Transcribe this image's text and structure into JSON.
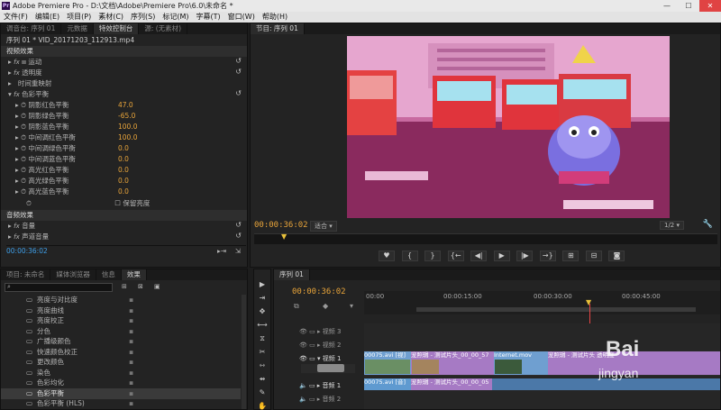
{
  "window": {
    "app_icon": "Pr",
    "title": "Adobe Premiere Pro - D:\\文档\\Adobe\\Premiere Pro\\6.0\\未命名 *",
    "min": "—",
    "max": "☐",
    "close": "✕"
  },
  "menu": [
    "文件(F)",
    "编辑(E)",
    "项目(P)",
    "素材(C)",
    "序列(S)",
    "标记(M)",
    "字幕(T)",
    "窗口(W)",
    "帮助(H)"
  ],
  "source_panel": {
    "tabs": [
      "源: (无素材)",
      "元数据",
      "特效控制台",
      "调音台: 序列 01"
    ],
    "active_tab": "特效控制台",
    "sequence_label": "序列 01 * VID_20171203_112913.mp4",
    "video_effects_header": "视频效果",
    "effects": [
      {
        "name": "运动",
        "has_icon": true
      },
      {
        "name": "透明度",
        "has_icon": false
      },
      {
        "name": "时间重映射",
        "has_icon": false
      },
      {
        "name": "色彩平衡",
        "has_icon": false
      }
    ],
    "params": [
      {
        "name": "阴影红色平衡",
        "value": "47.0",
        "color": "orange"
      },
      {
        "name": "阴影绿色平衡",
        "value": "-65.0",
        "color": "orange"
      },
      {
        "name": "阴影蓝色平衡",
        "value": "100.0",
        "color": "orange"
      },
      {
        "name": "中间调红色平衡",
        "value": "100.0",
        "color": "orange"
      },
      {
        "name": "中间调绿色平衡",
        "value": "0.0",
        "color": "orange"
      },
      {
        "name": "中间调蓝色平衡",
        "value": "0.0",
        "color": "orange"
      },
      {
        "name": "高光红色平衡",
        "value": "0.0",
        "color": "orange"
      },
      {
        "name": "高光绿色平衡",
        "value": "0.0",
        "color": "orange"
      },
      {
        "name": "高光蓝色平衡",
        "value": "0.0",
        "color": "orange"
      }
    ],
    "preserve_luminosity": "保留亮度",
    "audio_effects_header": "音频效果",
    "audio_effects": [
      "音量",
      "声道音量"
    ],
    "timecode": "00:00:36:02"
  },
  "program_monitor": {
    "tab": "节目: 序列 01",
    "timecode": "00:00:36:02",
    "fit": "适合",
    "ratio": "1/2",
    "controls": [
      "♥",
      "{",
      "}",
      "{←",
      "◀|",
      "▶",
      "|▶",
      "→}",
      "⊞",
      "⊟",
      "◙"
    ]
  },
  "project_panel": {
    "tabs": [
      "项目: 未命名",
      "媒体浏览器",
      "信息",
      "效果"
    ],
    "active_tab": "效果",
    "search_value": "",
    "items": [
      "亮度与对比度",
      "亮度曲线",
      "亮度校正",
      "分色",
      "广播级颜色",
      "快速颜色校正",
      "更改颜色",
      "染色",
      "色彩均化",
      "色彩平衡",
      "色彩平衡 (HLS)"
    ],
    "selected": "色彩平衡"
  },
  "tools": [
    "▶",
    "⇥",
    "✥",
    "⟷",
    "⧖",
    "✂",
    "⇿",
    "⇴",
    "✎",
    "✋",
    "🔍"
  ],
  "timeline": {
    "tab": "序列 01",
    "timecode": "00:00:36:02",
    "ruler": [
      "00:00",
      "00:00:15:00",
      "00:00:30:00",
      "00:00:45:00"
    ],
    "tracks": {
      "video3": "视频 3",
      "video2": "视频 2",
      "video1": "视频 1",
      "audio1": "音频 1",
      "audio2": "音频 2"
    },
    "clips": {
      "v1a": "00075.avi [视]",
      "v1b": "宠照辑 - 测试片头_00_00_57",
      "v1c": "Internet.mov",
      "v1d": "宠照辑 - 测试片头",
      "v1e": "透明度",
      "a1a": "00075.avi [音]",
      "a1b": "宠照辑 - 测试片头_00_00_05"
    }
  },
  "watermark": {
    "text": "Bai",
    "sub": "jingyan"
  },
  "colors": {
    "accent": "#e8a43a",
    "blue_clip": "#6f9fd0",
    "purple_clip": "#a67ac4",
    "audio_clip": "#5f9ad0",
    "playhead": "#e84545"
  }
}
